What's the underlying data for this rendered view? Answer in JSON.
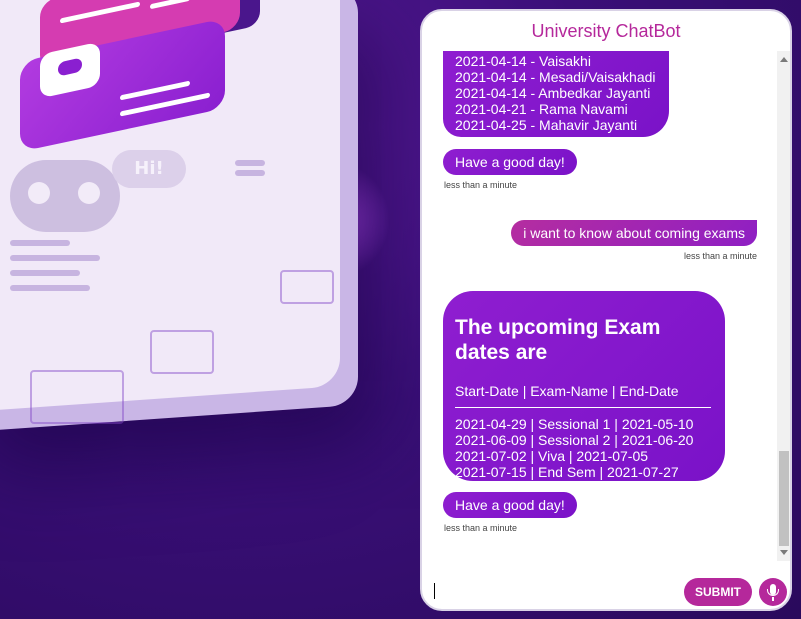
{
  "chat": {
    "title": "University ChatBot",
    "holidays": [
      "2021-04-14 - Vaisakhi",
      "2021-04-14 - Mesadi/Vaisakhadi",
      "2021-04-14 - Ambedkar Jayanti",
      "2021-04-21 - Rama Navami",
      "2021-04-25 - Mahavir Jayanti"
    ],
    "greeting_1": "Have a good day!",
    "time_1": "less than a minute",
    "user_message": "i want to know about coming exams",
    "time_2": "less than a minute",
    "exam": {
      "heading": "The upcoming Exam dates are",
      "header": "Start-Date | Exam-Name | End-Date",
      "rows": [
        "2021-04-29 | Sessional 1 | 2021-05-10",
        "2021-06-09 | Sessional 2 | 2021-06-20",
        "2021-07-02 | Viva | 2021-07-05",
        "2021-07-15 | End Sem | 2021-07-27"
      ]
    },
    "greeting_2": "Have a good day!",
    "time_3": "less than a minute"
  },
  "input": {
    "value": "",
    "placeholder": "",
    "submit_label": "SUBMIT"
  },
  "icons": {
    "mic": "microphone-icon"
  },
  "colors": {
    "accent": "#b5289b",
    "bubble": "#8a1cce"
  },
  "illustration": {
    "hi_text": "Hi!"
  }
}
